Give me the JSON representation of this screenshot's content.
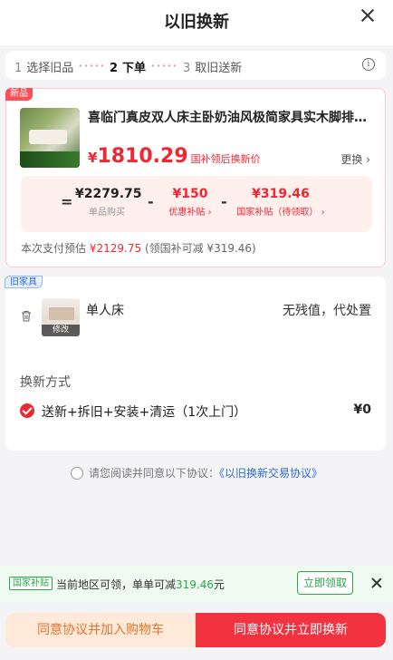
{
  "header": {
    "title": "以旧换新"
  },
  "steps": [
    {
      "num": "1",
      "label": "选择旧品"
    },
    {
      "num": "2",
      "label": "下单"
    },
    {
      "num": "3",
      "label": "取旧送新"
    }
  ],
  "new_item": {
    "tag": "新品",
    "title": "喜临门真皮双人床主卧奶油风极简家具实木脚排骨架大床",
    "price_symbol": "¥",
    "price": "1810.29",
    "price_note": "国补领后换新价",
    "change_label": "更换 ›",
    "calc": {
      "eq": "=",
      "minus": "-",
      "base_price": "¥2279.75",
      "base_label": "单品购买",
      "discount": "¥150",
      "discount_label": "优惠补贴 ›",
      "gov": "¥319.46",
      "gov_label": "国家补贴（待领取） ›"
    },
    "estimate_prefix": "本次支付预估",
    "estimate_amount": "¥2129.75",
    "estimate_suffix": "(领国补可减 ¥319.46)"
  },
  "old_item": {
    "tag": "旧家具",
    "name": "单人床",
    "status": "无残值，代处置",
    "modify_label": "修改",
    "method_title": "换新方式",
    "method_label": "送新+拆旧+安装+清运（1次上门）",
    "method_price": "¥0"
  },
  "agreement": {
    "prefix": "请您阅读并同意以下协议：",
    "link": "《以旧换新交易协议》"
  },
  "subsidy_banner": {
    "tag": "国家补贴",
    "text_prefix": "当前地区可领，单单可减",
    "amount": "319.46",
    "unit": "元",
    "button": "立即领取"
  },
  "footer": {
    "left_button": "同意协议并加入购物车",
    "right_button": "同意协议并立即换新"
  },
  "colors": {
    "accent_red": "#ee2732",
    "green": "#2aa84a",
    "link_blue": "#2d6bdc"
  }
}
